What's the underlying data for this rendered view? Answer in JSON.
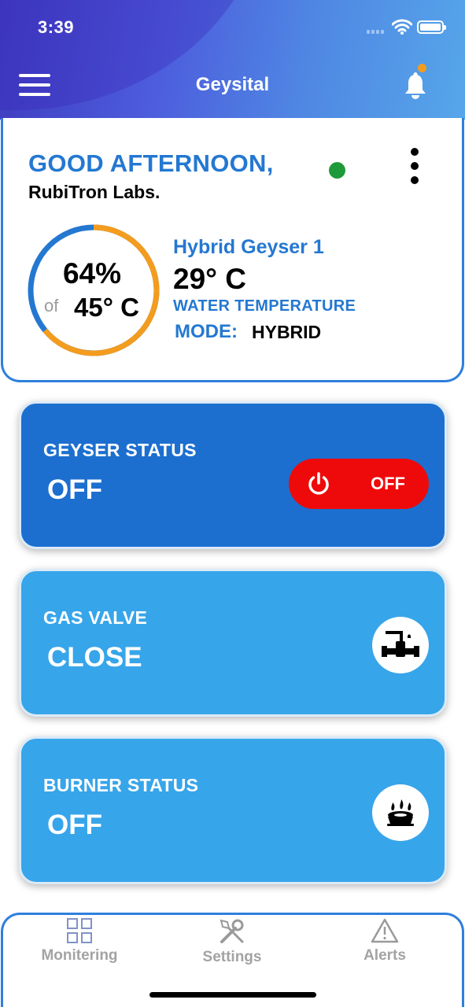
{
  "status_bar": {
    "time": "3:39"
  },
  "header": {
    "title": "Geysital"
  },
  "greeting": {
    "title": "GOOD AFTERNOON,",
    "name": "RubiTron Labs.",
    "connection_status_color": "#1e9a3a"
  },
  "gauge": {
    "percent_text": "64%",
    "of_text": "of",
    "max_temp": "45° C",
    "fill_fraction": 0.64,
    "fill_color": "#f39c1e",
    "track_color": "#2478d1"
  },
  "device": {
    "name": "Hybrid Geyser 1",
    "temperature": "29° C",
    "temperature_label": "WATER TEMPERATURE",
    "mode_label": "MODE:",
    "mode_value": "HYBRID"
  },
  "cards": {
    "geyser_status": {
      "label": "GEYSER STATUS",
      "value": "OFF",
      "toggle_label": "OFF",
      "toggle_color": "#ee0a0a"
    },
    "gas_valve": {
      "label": "GAS VALVE",
      "value": "CLOSE",
      "icon": "valve-icon"
    },
    "burner_status": {
      "label": "BURNER STATUS",
      "value": "OFF",
      "icon": "burner-icon"
    }
  },
  "tabbar": {
    "tabs": [
      {
        "label": "Monitering",
        "icon": "grid-icon"
      },
      {
        "label": "Settings",
        "icon": "tools-icon"
      },
      {
        "label": "Alerts",
        "icon": "warning-icon"
      }
    ]
  },
  "colors": {
    "accent": "#2478d1",
    "card_dark": "#1c6fcf",
    "card_light": "#37a5ea",
    "notification_dot": "#f39c1e"
  }
}
